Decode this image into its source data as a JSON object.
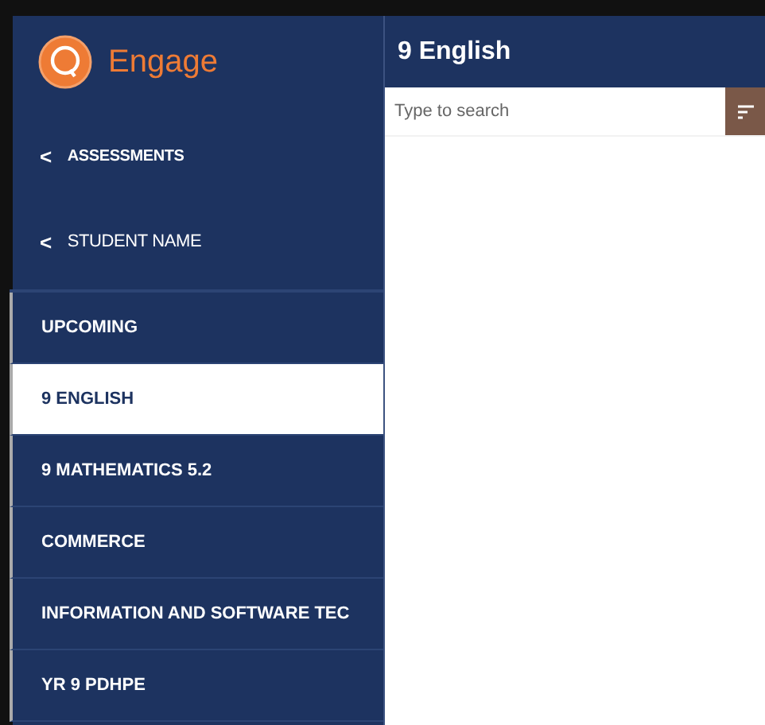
{
  "sidebar": {
    "logo_text": "Engage",
    "back_links": [
      {
        "icon": "<",
        "label": "ASSESSMENTS"
      },
      {
        "icon": "<",
        "label": "STUDENT NAME"
      }
    ],
    "items": [
      {
        "label": "UPCOMING",
        "selected": false
      },
      {
        "label": "9 ENGLISH",
        "selected": true
      },
      {
        "label": "9 MATHEMATICS 5.2",
        "selected": false
      },
      {
        "label": "COMMERCE",
        "selected": false
      },
      {
        "label": "INFORMATION AND SOFTWARE TEC",
        "selected": false
      },
      {
        "label": "YR 9 PDHPE",
        "selected": false
      }
    ]
  },
  "header": {
    "title": "9 English"
  },
  "search": {
    "placeholder": "Type to search"
  }
}
